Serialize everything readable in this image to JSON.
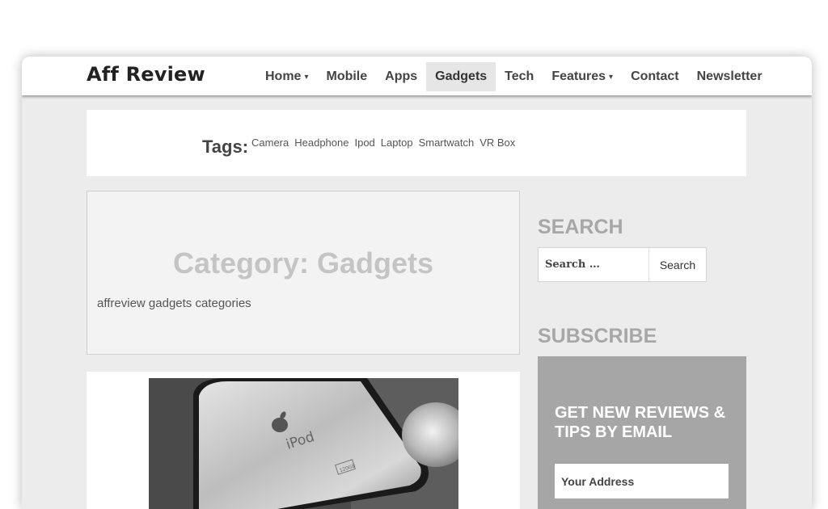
{
  "site": {
    "logo": "Aff Review"
  },
  "nav": {
    "items": [
      {
        "label": "Home",
        "dropdown": true
      },
      {
        "label": "Mobile",
        "dropdown": false
      },
      {
        "label": "Apps",
        "dropdown": false
      },
      {
        "label": "Gadgets",
        "dropdown": false,
        "active": true
      },
      {
        "label": "Tech",
        "dropdown": false
      },
      {
        "label": "Features",
        "dropdown": true
      },
      {
        "label": "Contact",
        "dropdown": false
      },
      {
        "label": "Newsletter",
        "dropdown": false
      }
    ],
    "caret": "▾"
  },
  "tags": {
    "title": "Tags:",
    "items": [
      "Camera",
      "Headphone",
      "Ipod",
      "Laptop",
      "Smartwatch",
      "VR Box"
    ]
  },
  "category": {
    "title": "Category: Gadgets",
    "description": "affreview gadgets categories"
  },
  "post": {
    "image": {
      "brand_mark": "iPod",
      "capacity_label": "120GB"
    }
  },
  "sidebar": {
    "search": {
      "title": "SEARCH",
      "placeholder": "Search …",
      "button": "Search"
    },
    "subscribe": {
      "title": "SUBSCRIBE",
      "heading": "GET NEW REVIEWS & TIPS BY EMAIL",
      "input_placeholder": "Your Address"
    }
  },
  "colors": {
    "page_bg": "#ececec",
    "header_bg": "#ffffff",
    "active_nav_bg": "#e6e6e6",
    "subscribe_bg": "#a6a6a6",
    "sidebar_title": "#a7a7a7"
  }
}
